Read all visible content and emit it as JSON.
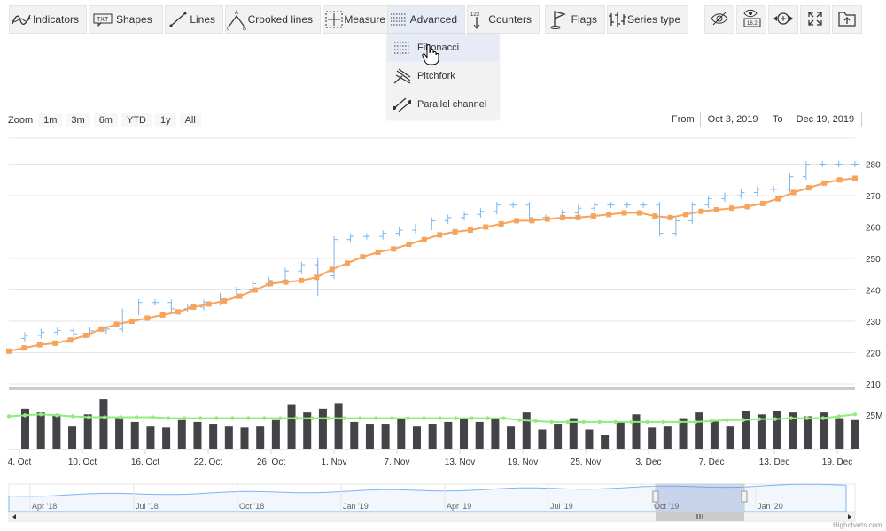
{
  "toolbar": {
    "items": [
      {
        "label": "Indicators",
        "icon": "indicators-icon"
      },
      {
        "label": "Shapes",
        "icon": "shapes-icon"
      },
      {
        "label": "Lines",
        "icon": "lines-icon"
      },
      {
        "label": "Crooked lines",
        "icon": "crooked-lines-icon"
      },
      {
        "label": "Measure",
        "icon": "measure-icon"
      },
      {
        "label": "Advanced",
        "icon": "advanced-icon"
      },
      {
        "label": "Counters",
        "icon": "counters-icon"
      },
      {
        "label": "Flags",
        "icon": "flags-icon"
      },
      {
        "label": "Series type",
        "icon": "series-type-icon"
      }
    ],
    "icon_buttons": [
      "toggle-annotations-icon",
      "current-price-indicator-icon",
      "zoom-change-icon",
      "fullscreen-icon",
      "save-chart-icon"
    ]
  },
  "dropdown": {
    "items": [
      {
        "label": "Fibonacci",
        "icon": "fibonacci-icon"
      },
      {
        "label": "Pitchfork",
        "icon": "pitchfork-icon"
      },
      {
        "label": "Parallel channel",
        "icon": "parallel-channel-icon"
      }
    ]
  },
  "zoom": {
    "label": "Zoom",
    "buttons": [
      "1m",
      "3m",
      "6m",
      "YTD",
      "1y",
      "All"
    ]
  },
  "range": {
    "from_label": "From",
    "from_value": "Oct 3, 2019",
    "to_label": "To",
    "to_value": "Dec 19, 2019"
  },
  "credits": "Highcharts.com",
  "colors": {
    "accent": "#7cb5ec",
    "sma": "#f7a35c",
    "volume": "#434348",
    "volume_sma": "#90ed7d",
    "navigator_mask": "rgba(102,133,194,0.3)"
  },
  "chart_data": {
    "type": "ohlc",
    "x_labels": [
      "4. Oct",
      "10. Oct",
      "16. Oct",
      "22. Oct",
      "26. Oct",
      "1. Nov",
      "7. Nov",
      "13. Nov",
      "19. Nov",
      "25. Nov",
      "3. Dec",
      "7. Dec",
      "13. Dec",
      "19. Dec"
    ],
    "y_ticks": [
      210,
      220,
      230,
      240,
      250,
      260,
      270,
      280
    ],
    "price": [
      225.5,
      226.5,
      227,
      226,
      227,
      227.5,
      233,
      236,
      236,
      234,
      234.5,
      236,
      238,
      240,
      242,
      243,
      246,
      248,
      244.5,
      256,
      257,
      257,
      258,
      259,
      260,
      262,
      263,
      264,
      265,
      267,
      267,
      263,
      263,
      264.5,
      266,
      267,
      267,
      267,
      267,
      258,
      262,
      267,
      269,
      270,
      271,
      272,
      272,
      276,
      280,
      280,
      280,
      280
    ],
    "sma": [
      220.5,
      221.5,
      222.5,
      223,
      224,
      225.5,
      227.5,
      229,
      230,
      231,
      232,
      233,
      234.5,
      235.5,
      236.5,
      238,
      240,
      242,
      242.5,
      243,
      244,
      246.5,
      248.5,
      250.5,
      252,
      253,
      254.5,
      256,
      257.5,
      258.5,
      259,
      260,
      261,
      262,
      262,
      262.5,
      263,
      263,
      263.5,
      264,
      264.5,
      264.5,
      263.5,
      263,
      264,
      265,
      265.5,
      266,
      266.5,
      267.5,
      269,
      271,
      272.5,
      274,
      275,
      275.5
    ],
    "volume": [
      21,
      19,
      18,
      12,
      18,
      26,
      16,
      14,
      12,
      11,
      15,
      14,
      13,
      12,
      11,
      12,
      15,
      23,
      19,
      21,
      24,
      14,
      13,
      13,
      16,
      12,
      13,
      14,
      16,
      14,
      16,
      12,
      19,
      10,
      13,
      16,
      10,
      7,
      14,
      18,
      11,
      12,
      16,
      19,
      15,
      12,
      20,
      18,
      20,
      19,
      17,
      19,
      16,
      15
    ],
    "volume_sma": [
      17,
      17.5,
      18,
      17.5,
      17,
      16.5,
      16.5,
      16.5,
      16.5,
      16.5,
      16,
      16,
      16,
      16,
      16,
      16,
      16,
      16,
      16,
      16,
      16,
      16,
      16,
      16,
      16,
      16,
      16,
      16,
      16,
      16,
      16,
      16,
      15,
      14.5,
      14,
      14,
      14,
      14,
      14,
      14,
      14,
      14,
      14,
      14,
      14.5,
      15,
      15,
      15.5,
      15.5,
      16,
      16,
      16,
      17,
      18
    ],
    "navigator": {
      "labels": [
        "Apr '18",
        "Jul '18",
        "Oct '18",
        "Jan '19",
        "Apr '19",
        "Jul '19",
        "Oct '19",
        "Jan '20"
      ]
    }
  }
}
